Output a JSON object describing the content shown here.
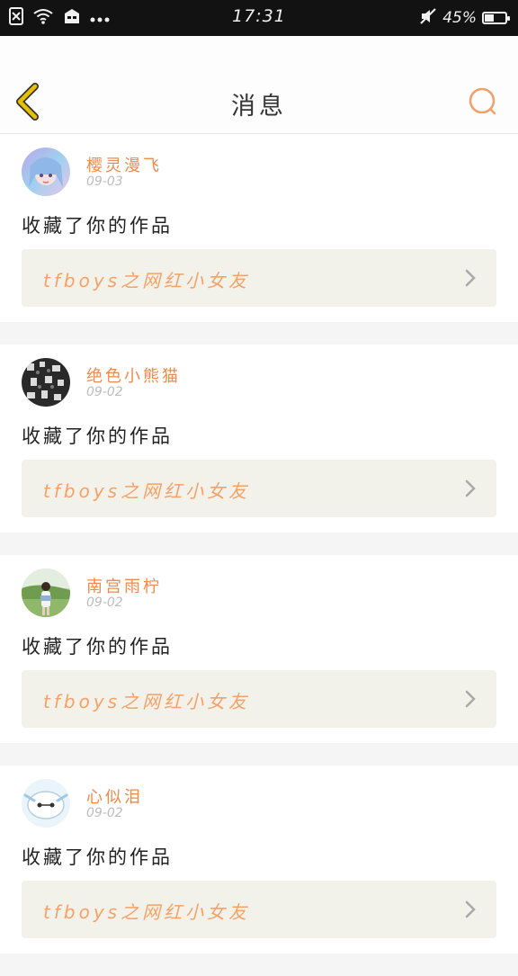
{
  "status_bar": {
    "time": "17:31",
    "battery_text": "45%",
    "battery_level": 0.45,
    "icons": [
      "sim-error-icon",
      "wifi-icon",
      "store-icon",
      "more-dots-icon",
      "mute-icon",
      "battery-icon"
    ]
  },
  "header": {
    "title": "消息",
    "back_icon": "chevron-left-icon",
    "search_icon": "search-icon"
  },
  "colors": {
    "accent": "#f08a4b",
    "work_title": "#f5a168",
    "back_arrow": "#e8c000",
    "link_bg": "#f2f2ea"
  },
  "messages": [
    {
      "username": "樱灵漫飞",
      "date": "09-03",
      "action": "收藏了你的作品",
      "work_title": "tfboys之网红小女友"
    },
    {
      "username": "绝色小熊猫",
      "date": "09-02",
      "action": "收藏了你的作品",
      "work_title": "tfboys之网红小女友"
    },
    {
      "username": "南宫雨柠",
      "date": "09-02",
      "action": "收藏了你的作品",
      "work_title": "tfboys之网红小女友"
    },
    {
      "username": "心似泪",
      "date": "09-02",
      "action": "收藏了你的作品",
      "work_title": "tfboys之网红小女友"
    }
  ]
}
